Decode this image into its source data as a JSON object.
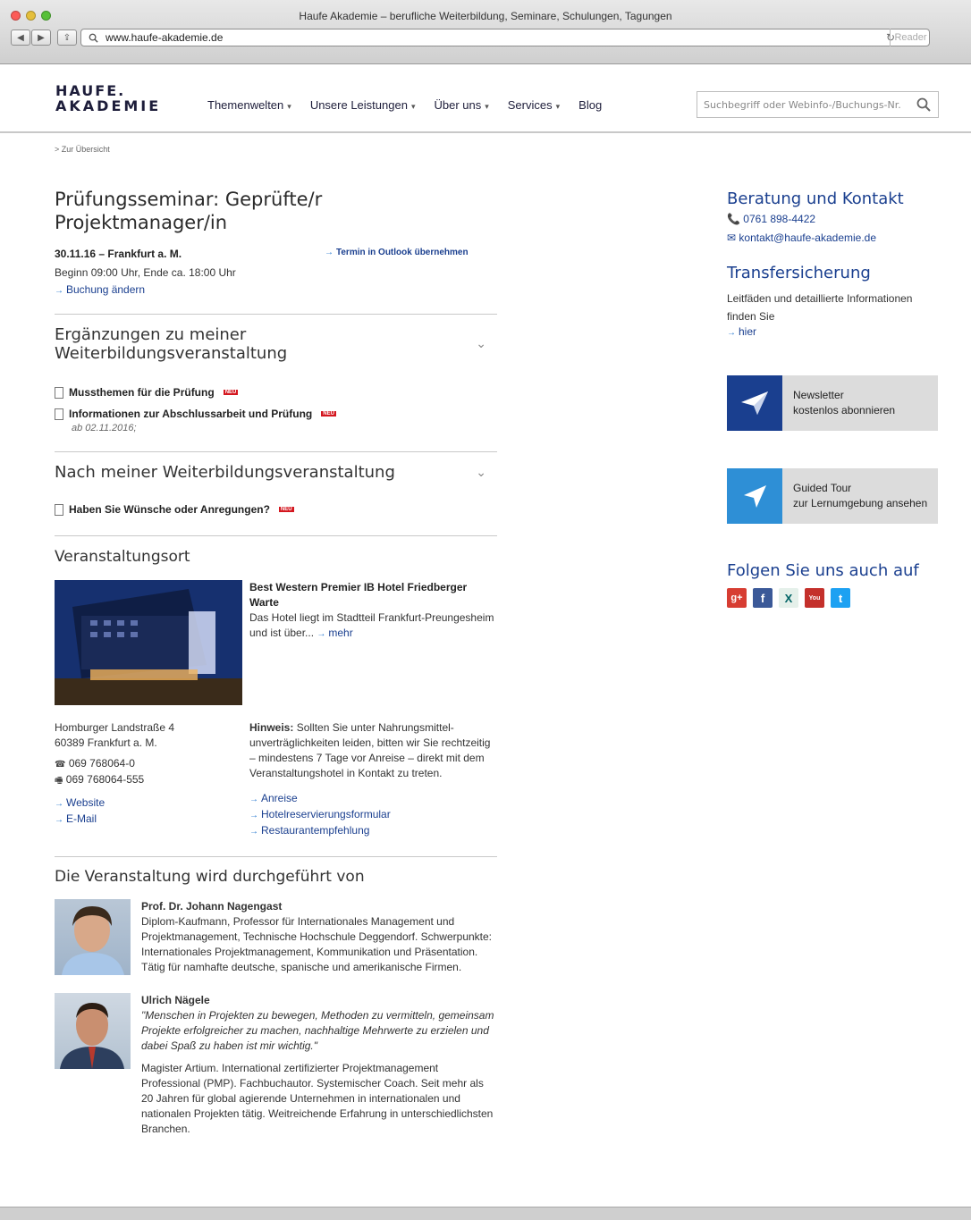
{
  "browser": {
    "window_title": "Haufe Akademie – berufliche Weiterbildung, Seminare, Schulungen, Tagungen",
    "url": "www.haufe-akademie.de",
    "reader_label": "Reader"
  },
  "header": {
    "logo_line1": "HAUFE.",
    "logo_line2": "AKADEMIE",
    "nav": [
      "Themenwelten",
      "Unsere Leistungen",
      "Über uns",
      "Services",
      "Blog"
    ],
    "search_placeholder": "Suchbegriff oder Webinfo-/Buchungs-Nr."
  },
  "breadcrumb": "> Zur Übersicht",
  "event": {
    "title_line1": "Prüfungsseminar: Geprüfte/r",
    "title_line2": "Projektmanager/in",
    "date_place": "30.11.16 – Frankfurt a. M.",
    "outlook_link": "Termin in Outlook übernehmen",
    "time": "Beginn 09:00 Uhr, Ende ca. 18:00 Uhr",
    "change_booking": "Buchung ändern"
  },
  "supplements": {
    "heading": "Ergänzungen zu meiner Weiterbildungsveranstaltung",
    "docs": [
      {
        "label": "Mussthemen für die Prüfung",
        "badge": "NEU"
      },
      {
        "label": "Informationen zur Abschlussarbeit und Prüfung",
        "badge": "NEU",
        "note": "ab 02.11.2016;"
      }
    ]
  },
  "after": {
    "heading": "Nach meiner Weiterbildungsveranstaltung",
    "docs": [
      {
        "label": "Haben Sie Wünsche oder Anregungen?",
        "badge": "NEU"
      }
    ]
  },
  "venue": {
    "heading": "Veranstaltungsort",
    "hotel_name": "Best Western Premier IB Hotel Friedberger Warte",
    "hotel_desc": "Das Hotel liegt im Stadtteil Frankfurt-Preungesheim und ist über...",
    "more": "mehr",
    "street": "Homburger Landstraße 4",
    "city": "60389 Frankfurt a. M.",
    "phone": "069 768064-0",
    "fax": "069 768064-555",
    "website": "Website",
    "email": "E-Mail",
    "hint_label": "Hinweis:",
    "hint_text": "Sollten Sie unter Nahrungsmittel­unverträglichkeiten leiden, bitten wir Sie rechtzeitig – mindestens 7 Tage vor Anreise – direkt mit dem Veranstaltungshotel in Kontakt zu treten.",
    "links": [
      "Anreise",
      "Hotelreservierungsformular",
      "Restaurantempfehlung"
    ]
  },
  "trainers": {
    "heading": "Die Veranstaltung wird durchgeführt von",
    "people": [
      {
        "name": "Prof. Dr. Johann Nagengast",
        "bio": "Diplom-Kaufmann, Professor für Internationales Management und Projektmanagement, Technische Hochschule Deggendorf. Schwerpunkte: Internationales Projektmanagement, Kommunikation und Präsentation. Tätig für namhafte deutsche, spanische und amerikanische Firmen."
      },
      {
        "name": "Ulrich Nägele",
        "quote": "\"Menschen in Projekten zu bewegen, Methoden zu vermitteln, gemeinsam Projekte erfolgreicher zu machen, nachhaltige Mehrwerte zu erzielen und dabei Spaß zu haben ist mir wichtig.\"",
        "bio": "Magister Artium. International zertifizierter Projektmanagement Professional (PMP). Fachbuchautor. Systemischer Coach. Seit mehr als 20 Jahren für global agierende Unternehmen in internationalen und nationalen Projekten tätig. Weitreichende Erfahrung in unterschiedlichsten Branchen."
      }
    ]
  },
  "sidebar": {
    "contact_heading": "Beratung und Kontakt",
    "phone": "0761 898-4422",
    "email": "kontakt@haufe-akademie.de",
    "transfer_heading": "Transfersicherung",
    "transfer_text": "Leitfäden und detaillierte Informationen finden Sie",
    "transfer_link": "hier",
    "newsletter_title": "Newsletter",
    "newsletter_sub": "kostenlos abonnieren",
    "tour_title": "Guided Tour",
    "tour_sub": "zur Lernumgebung ansehen",
    "follow_heading": "Folgen Sie uns auch auf",
    "social": [
      {
        "name": "google-plus",
        "glyph": "g+",
        "color": "#d73d32"
      },
      {
        "name": "facebook",
        "glyph": "f",
        "color": "#3b5998"
      },
      {
        "name": "xing",
        "glyph": "X",
        "color": "#e5f0ea"
      },
      {
        "name": "youtube",
        "glyph": "You",
        "color": "#c4302b"
      },
      {
        "name": "twitter",
        "glyph": "t",
        "color": "#1da1f2"
      }
    ]
  }
}
